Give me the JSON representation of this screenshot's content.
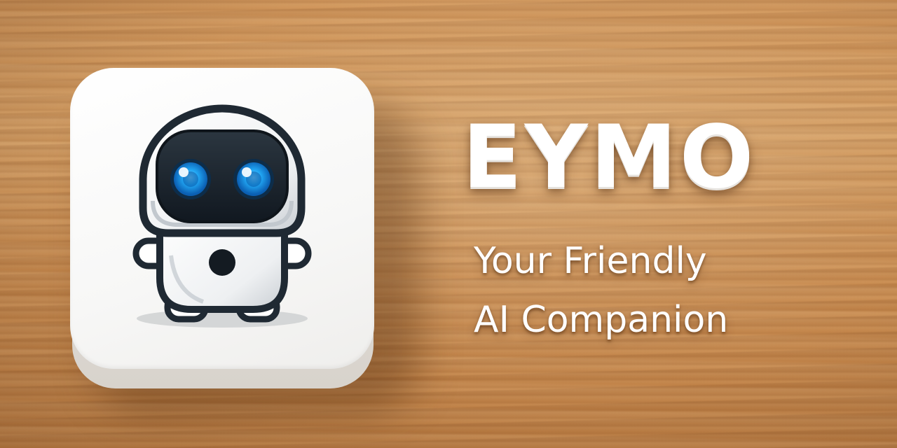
{
  "brand": {
    "title": "EYMO",
    "tagline_line1": "Your Friendly",
    "tagline_line2": "AI Companion"
  },
  "icon": {
    "name": "robot-mascot-icon",
    "eye_color": "#1e9ef0",
    "tile_color": "#ffffff"
  },
  "colors": {
    "wood": "#cf9357",
    "text": "#ffffff",
    "robot_dark": "#1f2933"
  }
}
